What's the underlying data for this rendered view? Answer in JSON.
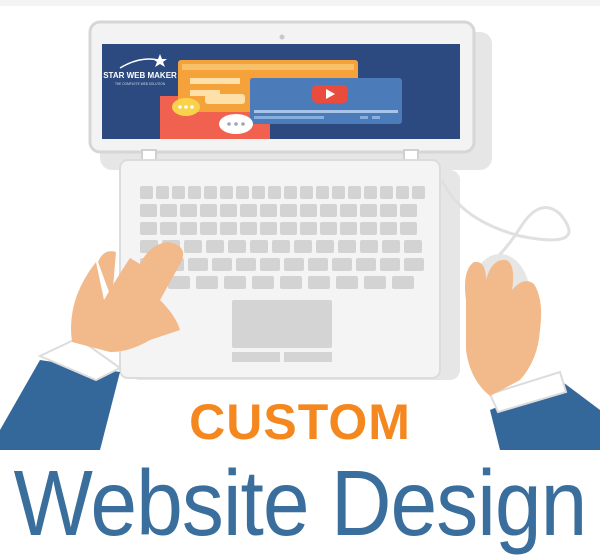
{
  "logo": {
    "text": "STAR WEB MAKER",
    "tagline": "THE COMPLETE WEB SOLUTION"
  },
  "headline": {
    "line1": "CUSTOM",
    "line2": "Website Design"
  },
  "colors": {
    "orange": "#f5871f",
    "blue": "#3a6e9c",
    "laptop_body": "#ececec",
    "laptop_frame": "#d9d9d9",
    "screen_bg": "#2c4a80",
    "skin": "#f2b98a",
    "sleeve": "#35689a",
    "coral": "#f0614f",
    "yellow": "#f8d24a",
    "play_red": "#e94b3c"
  },
  "icons": {
    "play": "play-icon",
    "star": "star-icon",
    "chat": "chat-bubble-icon"
  }
}
